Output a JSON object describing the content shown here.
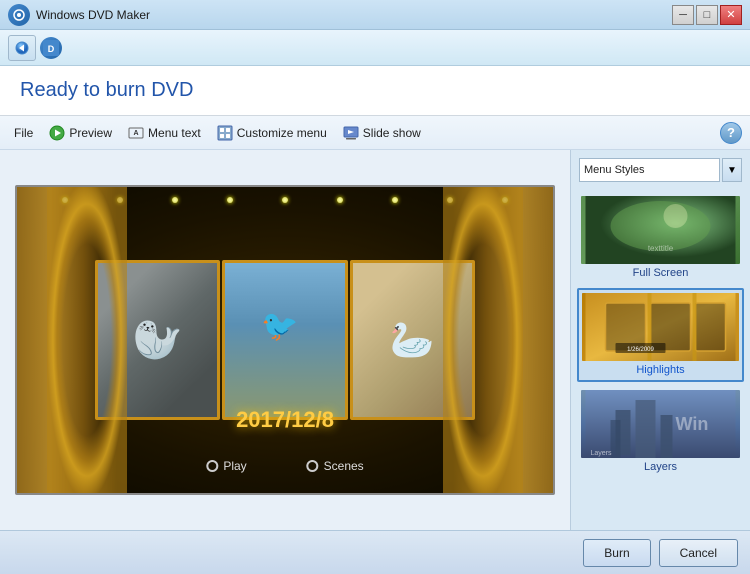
{
  "titleBar": {
    "title": "Windows DVD Maker",
    "controls": {
      "minimize": "─",
      "maximize": "□",
      "close": "✕"
    }
  },
  "header": {
    "title": "Ready to burn DVD"
  },
  "toolbar": {
    "file": "File",
    "preview": "Preview",
    "menuText": "Menu text",
    "customizeMenu": "Customize menu",
    "slideShow": "Slide show",
    "help": "?"
  },
  "preview": {
    "date": "2017/12/8",
    "playLabel": "Play",
    "scenesLabel": "Scenes"
  },
  "rightPanel": {
    "dropdownLabel": "Menu Styles",
    "styles": [
      {
        "name": "Full Screen",
        "selected": false
      },
      {
        "name": "Highlights",
        "selected": true
      },
      {
        "name": "Layers",
        "selected": false
      }
    ],
    "highlightsDate": "1/26/2009"
  },
  "bottomBar": {
    "burnLabel": "Burn",
    "cancelLabel": "Cancel"
  }
}
